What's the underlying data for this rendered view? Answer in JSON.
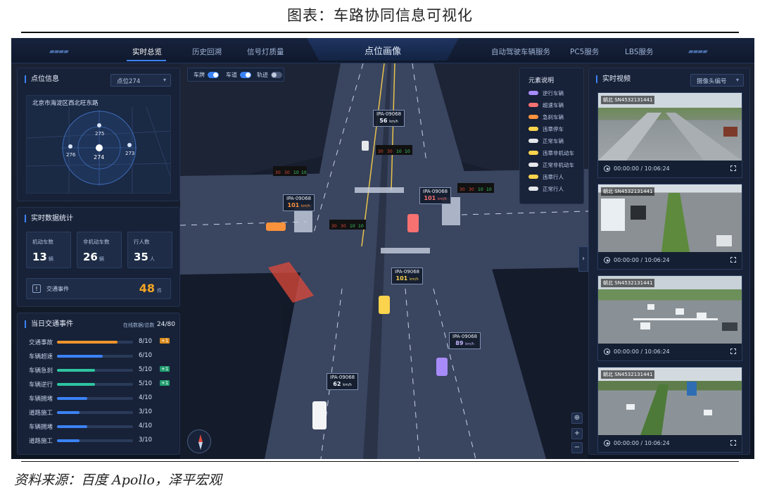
{
  "figure": {
    "title": "图表：车路协同信息可视化",
    "source": "资料来源：百度 Apollo，泽平宏观"
  },
  "nav": {
    "left_items": [
      "实时总览",
      "历史回溯",
      "信号灯质量"
    ],
    "center_title": "点位画像",
    "right_items": [
      "自动驾驶车辆服务",
      "PC5服务",
      "LBS服务"
    ]
  },
  "location_panel": {
    "title": "点位信息",
    "selected_point": "点位274",
    "address": "北京市海淀区西北旺东路",
    "points": [
      "275",
      "276",
      "274",
      "273"
    ]
  },
  "stats_panel": {
    "title": "实时数据统计",
    "cards": [
      {
        "label": "机动车数",
        "value": "13",
        "unit": "辆"
      },
      {
        "label": "非机动车数",
        "value": "26",
        "unit": "辆"
      },
      {
        "label": "行人数",
        "value": "35",
        "unit": "人"
      }
    ],
    "event": {
      "icon": "!",
      "label": "交通事件",
      "value": "48",
      "unit": "件"
    }
  },
  "incidents_panel": {
    "title": "当日交通事件",
    "online_label": "在线数据/总数",
    "online_value": "24/80",
    "rows": [
      {
        "label": "交通事故",
        "value": "8/10",
        "ratio": 0.8,
        "color": "#f0932b",
        "badge": "+1",
        "badge_color": "#d98a1a"
      },
      {
        "label": "车辆超速",
        "value": "6/10",
        "ratio": 0.6,
        "color": "#3b82f6",
        "badge": "",
        "badge_color": ""
      },
      {
        "label": "车辆急刹",
        "value": "5/10",
        "ratio": 0.5,
        "color": "#2ec4a0",
        "badge": "+1",
        "badge_color": "#1f9e6e"
      },
      {
        "label": "车辆逆行",
        "value": "5/10",
        "ratio": 0.5,
        "color": "#2ec4a0",
        "badge": "+1",
        "badge_color": "#1f9e6e"
      },
      {
        "label": "车辆拥堵",
        "value": "4/10",
        "ratio": 0.4,
        "color": "#3b82f6",
        "badge": "",
        "badge_color": ""
      },
      {
        "label": "道路施工",
        "value": "3/10",
        "ratio": 0.3,
        "color": "#3b82f6",
        "badge": "",
        "badge_color": ""
      },
      {
        "label": "车辆拥堵",
        "value": "4/10",
        "ratio": 0.4,
        "color": "#3b82f6",
        "badge": "",
        "badge_color": ""
      },
      {
        "label": "道路施工",
        "value": "3/10",
        "ratio": 0.3,
        "color": "#3b82f6",
        "badge": "",
        "badge_color": ""
      }
    ]
  },
  "toggles": [
    {
      "label": "车牌",
      "on": true
    },
    {
      "label": "车道",
      "on": true
    },
    {
      "label": "轨迹",
      "on": false
    }
  ],
  "legend": {
    "title": "元素说明",
    "items": [
      {
        "label": "逆行车辆",
        "color": "#a78bfa"
      },
      {
        "label": "超速车辆",
        "color": "#f87171"
      },
      {
        "label": "急刹车辆",
        "color": "#fb923c"
      },
      {
        "label": "违章停车",
        "color": "#fcd34d"
      },
      {
        "label": "正常车辆",
        "color": "#e5e7eb"
      },
      {
        "label": "违章非机动车",
        "color": "#fcd34d"
      },
      {
        "label": "正常非机动车",
        "color": "#e5e7eb"
      },
      {
        "label": "违章行人",
        "color": "#fcd34d"
      },
      {
        "label": "正常行人",
        "color": "#e5e7eb"
      }
    ]
  },
  "vehicles": [
    {
      "plate": "IPA·09068",
      "speed": "56",
      "unit": "km/h"
    },
    {
      "plate": "IPA·09068",
      "speed": "101",
      "unit": "km/h"
    },
    {
      "plate": "IPA·09068",
      "speed": "101",
      "unit": "km/h"
    },
    {
      "plate": "IPA·09068",
      "speed": "101",
      "unit": "km/h"
    },
    {
      "plate": "IPA·09068",
      "speed": "89",
      "unit": "km/h"
    },
    {
      "plate": "IPA·09068",
      "speed": "62",
      "unit": "km/h"
    }
  ],
  "video_panel": {
    "title": "实时视频",
    "camera_select": "摄像头编号",
    "videos": [
      {
        "id": "朝北 SN4532131441",
        "time": "00:00:00 / 10:06:24"
      },
      {
        "id": "朝北 SN4532131441",
        "time": "00:00:00 / 10:06:24"
      },
      {
        "id": "朝北 SN4532131441",
        "time": "00:00:00 / 10:06:24"
      },
      {
        "id": "朝北 SN4532131441",
        "time": "00:00:00 / 10:06:24"
      }
    ]
  }
}
